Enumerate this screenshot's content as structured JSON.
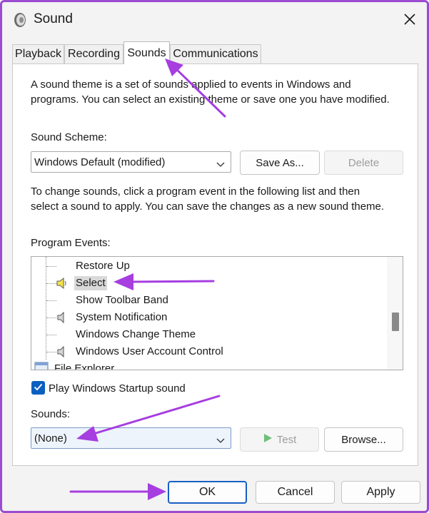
{
  "window": {
    "title": "Sound"
  },
  "tabs": [
    {
      "label": "Playback"
    },
    {
      "label": "Recording"
    },
    {
      "label": "Sounds"
    },
    {
      "label": "Communications"
    }
  ],
  "description": {
    "line1": "A sound theme is a set of sounds applied to events in Windows and",
    "line2": "programs.  You can select an existing theme or save one you have modified."
  },
  "scheme": {
    "label": "Sound Scheme:",
    "value": "Windows Default (modified)",
    "save_as": "Save As...",
    "delete": "Delete"
  },
  "instructions": {
    "line1": "To change sounds, click a program event in the following list and then",
    "line2": "select a sound to apply.  You can save the changes as a new sound theme."
  },
  "events": {
    "label": "Program Events:",
    "items": [
      {
        "label": "Restore Up",
        "has_sound": false
      },
      {
        "label": "Select",
        "has_sound": true
      },
      {
        "label": "Show Toolbar Band",
        "has_sound": false
      },
      {
        "label": "System Notification",
        "has_sound": true
      },
      {
        "label": "Windows Change Theme",
        "has_sound": false
      },
      {
        "label": "Windows User Account Control",
        "has_sound": true
      }
    ],
    "partial_item": "File Explorer",
    "selected": "Select"
  },
  "startup": {
    "label": "Play Windows Startup sound",
    "checked": true
  },
  "sounds": {
    "label": "Sounds:",
    "value": "(None)",
    "test": "Test",
    "browse": "Browse..."
  },
  "footer": {
    "ok": "OK",
    "cancel": "Cancel",
    "apply": "Apply"
  },
  "colors": {
    "accent": "#0a5fbf",
    "annotation_arrow": "#a63ee0"
  }
}
